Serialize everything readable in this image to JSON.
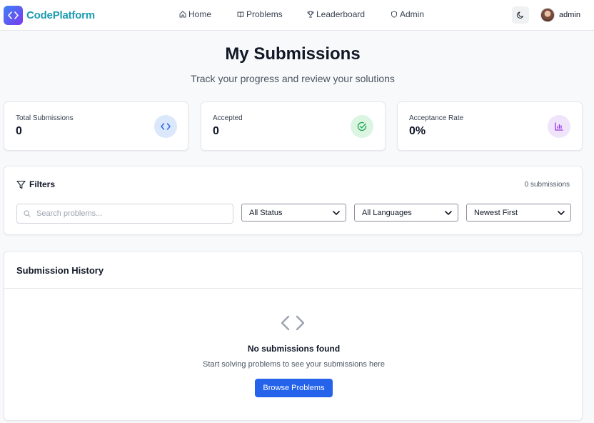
{
  "nav": {
    "brand": "CodePlatform",
    "links": [
      {
        "label": "Home",
        "icon": "home-icon"
      },
      {
        "label": "Problems",
        "icon": "book-icon"
      },
      {
        "label": "Leaderboard",
        "icon": "trophy-icon"
      },
      {
        "label": "Admin",
        "icon": "shield-icon"
      }
    ],
    "theme_icon": "moon-icon",
    "user": "admin"
  },
  "header": {
    "title": "My Submissions",
    "subtitle": "Track your progress and review your solutions"
  },
  "stats": [
    {
      "label": "Total Submissions",
      "value": "0",
      "icon": "code-icon",
      "color": "#2563eb",
      "bg": "#dbe7fb"
    },
    {
      "label": "Accepted",
      "value": "0",
      "icon": "check-circle-icon",
      "color": "#16a34a",
      "bg": "#dcf5e3"
    },
    {
      "label": "Acceptance Rate",
      "value": "0%",
      "icon": "bar-chart-icon",
      "color": "#9333ea",
      "bg": "#f0e4fb"
    }
  ],
  "filters": {
    "title": "Filters",
    "count": "0 submissions",
    "search_placeholder": "Search problems...",
    "status": "All Status",
    "language": "All Languages",
    "sort": "Newest First"
  },
  "history": {
    "title": "Submission History",
    "empty_title": "No submissions found",
    "empty_sub": "Start solving problems to see your submissions here",
    "browse": "Browse Problems"
  },
  "colors": {
    "accent": "#2563eb",
    "brand": "#1a9bb0"
  }
}
